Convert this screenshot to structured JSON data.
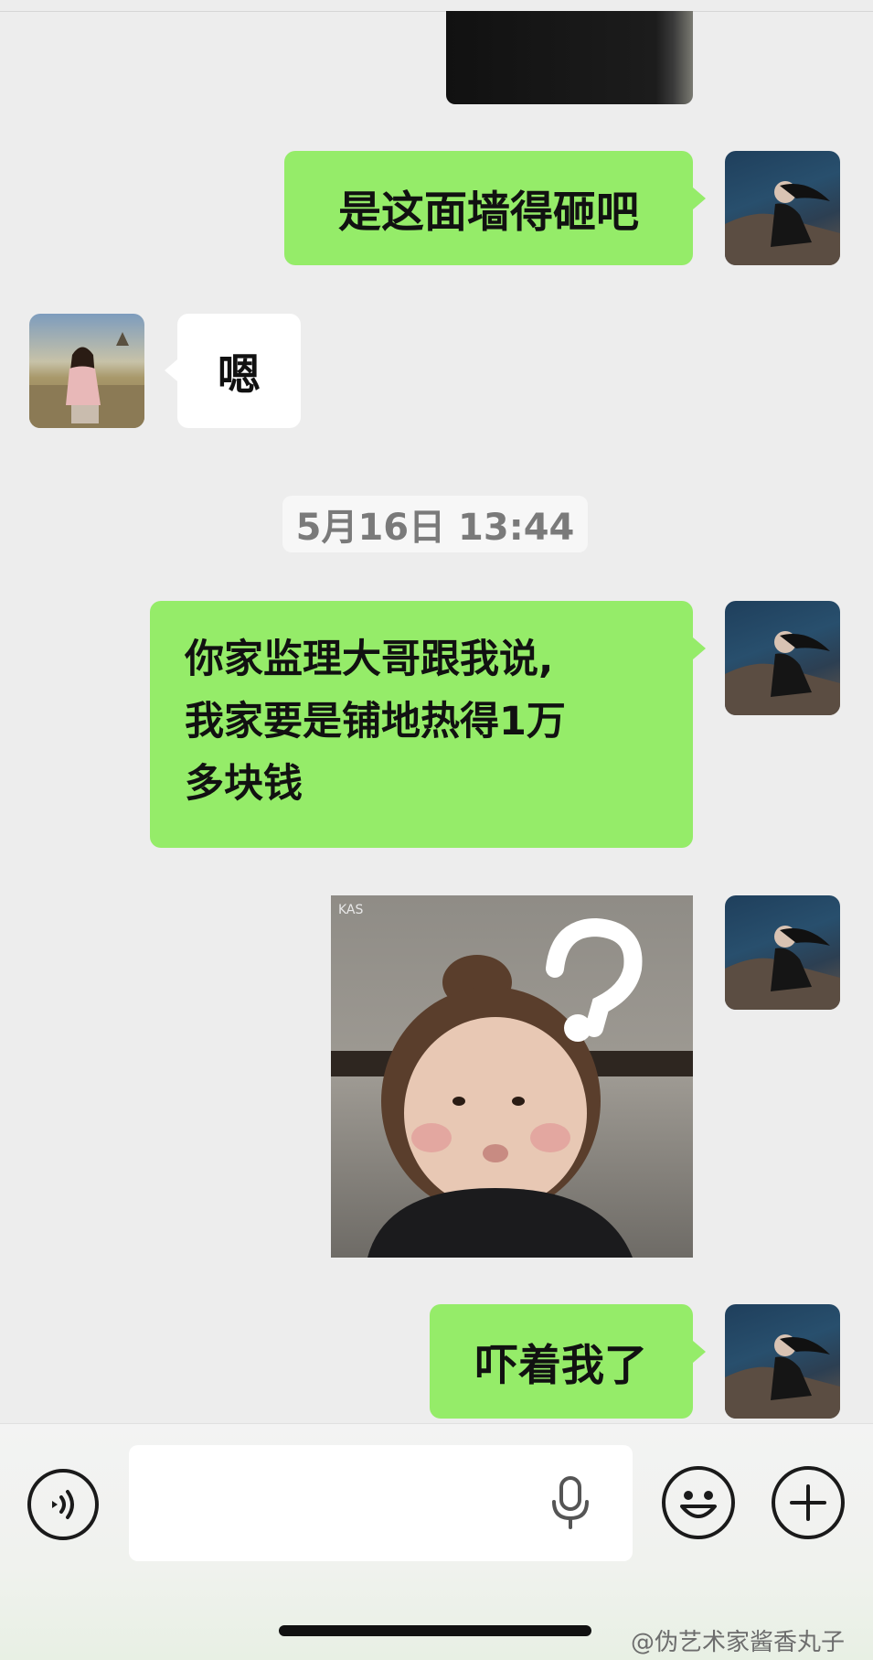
{
  "messages": {
    "m1": "是这面墙得砸吧",
    "m2": "嗯",
    "m3_line1": "你家监理大哥跟我说,",
    "m3_line2": "我家要是铺地热得1万",
    "m3_line3": "多块钱",
    "m4": "吓着我了"
  },
  "timestamp": "5月16日 13:44",
  "watermark": "@伪艺术家酱香丸子",
  "colors": {
    "my_bubble": "#95ec69",
    "other_bubble": "#ffffff",
    "background": "#ededed"
  },
  "icons": [
    "voice-icon",
    "microphone-icon",
    "emoji-icon",
    "plus-icon"
  ]
}
